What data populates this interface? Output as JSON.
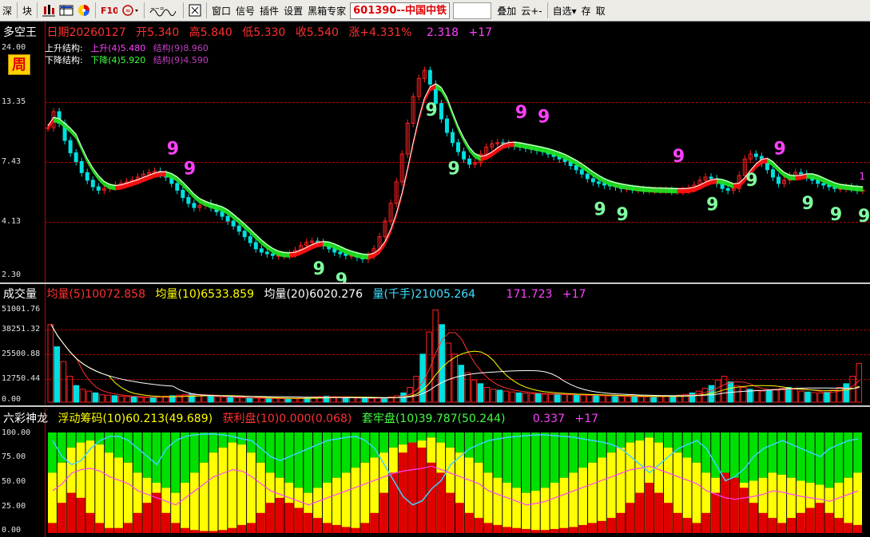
{
  "toolbar": {
    "buttons": [
      "深",
      "块",
      "窗口",
      "信号",
      "插件",
      "设置",
      "黑箱专家",
      "叠加",
      "云+-",
      "自选▾",
      "存",
      "取"
    ],
    "stock": "601390--中国中铁"
  },
  "price_panel": {
    "title": "多空王",
    "date": "日期20260127",
    "open": "开5.340",
    "high": "高5.840",
    "low": "低5.330",
    "close": "收5.540",
    "change": "涨+4.331%",
    "extra1": "2.318",
    "extra2": "+17",
    "period_badge": "周",
    "legend_up_label": "上升结构:",
    "legend_up_a": "上升(4)5.480",
    "legend_up_b": "结构(9)8.960",
    "legend_down_label": "下降结构:",
    "legend_down_a": "下降(4)5.920",
    "legend_down_b": "结构(9)4.590",
    "y_ticks": [
      "24.00",
      "13.35",
      "7.43",
      "4.13",
      "2.30"
    ],
    "right_marker": "1"
  },
  "volume_panel": {
    "title": "成交量",
    "ma5": "均量(5)10072.858",
    "ma10": "均量(10)6533.859",
    "ma20": "均量(20)6020.276",
    "vol": "量(千手)21005.264",
    "extra1": "171.723",
    "extra2": "+17",
    "y_ticks": [
      "51001.76",
      "38251.32",
      "25500.88",
      "12750.44",
      "0.00"
    ]
  },
  "chip_panel": {
    "title": "六彩神龙",
    "float": "浮动筹码(10)60.213(49.689)",
    "profit": "获利盘(10)0.000(0.068)",
    "trapped": "套牢盘(10)39.787(50.244)",
    "extra1": "0.337",
    "extra2": "+17",
    "y_ticks": [
      "100.00",
      "75.00",
      "50.00",
      "25.00",
      "0.00"
    ]
  },
  "colors": {
    "up": "#ff2020",
    "down": "#00e0e0",
    "bull_band": "#ff1010",
    "bear_band": "#20e020",
    "signal9_up": "#ff40ff",
    "signal9_down": "#80ffa0",
    "chip_green": "#00e000",
    "chip_yellow": "#ffff00",
    "chip_red": "#e00000"
  },
  "chart_data": [
    {
      "type": "line",
      "name": "price",
      "x": [
        0,
        4,
        8,
        12,
        16,
        20,
        24,
        28,
        32,
        36,
        40,
        44,
        48,
        52,
        56,
        60,
        64,
        68,
        72,
        76,
        80,
        84,
        88,
        92,
        96,
        100,
        104,
        108,
        112,
        116,
        120,
        124,
        128,
        132,
        136,
        140,
        144,
        148,
        152,
        156,
        160,
        164,
        168,
        172,
        176,
        180,
        184,
        188,
        192,
        196,
        200,
        204,
        208,
        212,
        216,
        220,
        224,
        228,
        232,
        236,
        240,
        244,
        248,
        252,
        256,
        260,
        264,
        268,
        272,
        276,
        280,
        284,
        288,
        292,
        296,
        300,
        304,
        308,
        312,
        316,
        320,
        324,
        328,
        332,
        336,
        340,
        344,
        348,
        352,
        356,
        360,
        364,
        368,
        372,
        376,
        380,
        384,
        388,
        392,
        396,
        400,
        404,
        408,
        412,
        416,
        420,
        424,
        428,
        432,
        436,
        440,
        444,
        448,
        452,
        456,
        460,
        464,
        468,
        472,
        476,
        480,
        484,
        488,
        492,
        496,
        500,
        504,
        508,
        512,
        516,
        520,
        524,
        528,
        532,
        536,
        540,
        544,
        548,
        552,
        556,
        560,
        564,
        568,
        572,
        576,
        580,
        584,
        588,
        592,
        596,
        600,
        604,
        608,
        612,
        616,
        620,
        624,
        628,
        632,
        636,
        640,
        644,
        648,
        652,
        656,
        660,
        664,
        668,
        672,
        676,
        680,
        684,
        688,
        692,
        696,
        700,
        704,
        708,
        712,
        716,
        720,
        724,
        728,
        732,
        736,
        740,
        744,
        748,
        752,
        756,
        760,
        764,
        768,
        772,
        776,
        780,
        784,
        788,
        792,
        796,
        800,
        804,
        808,
        812,
        816,
        820,
        824,
        828,
        832,
        836,
        840,
        844,
        848,
        852,
        856,
        860,
        864,
        868,
        872,
        876,
        880,
        884,
        888,
        892,
        896,
        900,
        904,
        908,
        912,
        916,
        920,
        924,
        928,
        932,
        936,
        940,
        944,
        948,
        952,
        956,
        960,
        964,
        968,
        972,
        976,
        980,
        984,
        988,
        992,
        996,
        1000,
        1004,
        1008,
        1012,
        1016
      ],
      "y": [
        10.5,
        12.4,
        11.0,
        9.2,
        8.1,
        7.4,
        6.6,
        6.1,
        5.7,
        5.5,
        5.6,
        5.7,
        5.8,
        5.9,
        6.0,
        6.1,
        6.3,
        6.5,
        6.6,
        6.7,
        6.5,
        6.3,
        5.9,
        5.5,
        5.1,
        4.8,
        4.6,
        4.7,
        4.8,
        4.6,
        4.4,
        4.2,
        4.0,
        3.8,
        3.6,
        3.4,
        3.2,
        3.0,
        2.9,
        2.85,
        2.8,
        2.8,
        2.8,
        2.85,
        2.95,
        3.1,
        3.2,
        3.25,
        3.2,
        3.1,
        3.0,
        2.9,
        2.85,
        2.8,
        2.8,
        2.75,
        2.7,
        2.8,
        3.0,
        3.4,
        4.0,
        4.8,
        6.0,
        8.0,
        11.0,
        14.5,
        17.5,
        19.0,
        16.5,
        13.5,
        11.5,
        10.0,
        9.0,
        8.2,
        7.6,
        7.2,
        7.3,
        8.0,
        8.6,
        8.9,
        9.0,
        8.9,
        8.8,
        8.7,
        8.6,
        8.5,
        8.4,
        8.3,
        8.2,
        8.0,
        7.8,
        7.6,
        7.4,
        7.1,
        6.8,
        6.5,
        6.2,
        6.0,
        5.9,
        5.8,
        5.75,
        5.7,
        5.6,
        5.6,
        5.55,
        5.55,
        5.5,
        5.5,
        5.5,
        5.5,
        5.5,
        5.45,
        5.45,
        5.5,
        5.6,
        5.8,
        6.1,
        6.3,
        6.2,
        5.9,
        5.6,
        5.5,
        5.6,
        6.4,
        7.6,
        8.0,
        7.8,
        7.3,
        6.8,
        6.3,
        5.9,
        6.1,
        6.4,
        6.6,
        6.5,
        6.3,
        6.1,
        5.9,
        5.8,
        5.7,
        5.6,
        5.6,
        5.7,
        5.6,
        5.5,
        5.5
      ],
      "xlabel": "",
      "ylabel": "",
      "ylim": [
        2.3,
        24.0
      ],
      "yscale": "log"
    },
    {
      "type": "bar",
      "name": "volume",
      "values": [
        42000,
        30000,
        22000,
        14000,
        9000,
        7000,
        6000,
        5000,
        4000,
        3800,
        3500,
        3200,
        3000,
        2800,
        2600,
        2500,
        2600,
        2800,
        3200,
        3500,
        3800,
        4200,
        4500,
        4000,
        3600,
        3200,
        3000,
        2800,
        2600,
        2500,
        2400,
        2300,
        2200,
        2100,
        2000,
        2000,
        1900,
        1900,
        2000,
        2200,
        2500,
        2800,
        3000,
        3200,
        3000,
        2800,
        2600,
        2400,
        2200,
        2100,
        2100,
        2200,
        2400,
        2800,
        3500,
        5000,
        8000,
        14000,
        26000,
        38000,
        50000,
        42000,
        32000,
        26000,
        20000,
        16000,
        12000,
        10000,
        8000,
        7000,
        6500,
        6000,
        5500,
        5000,
        4800,
        4600,
        4500,
        4400,
        4300,
        4200,
        4100,
        4000,
        3900,
        3800,
        3700,
        3600,
        3500,
        3400,
        3300,
        3200,
        3100,
        3000,
        2900,
        2900,
        3000,
        3100,
        3200,
        3400,
        3800,
        4200,
        5000,
        6000,
        7500,
        9000,
        12000,
        14000,
        11000,
        9000,
        8000,
        7000,
        6500,
        6000,
        6500,
        7000,
        7500,
        8000,
        7000,
        6000,
        5500,
        5200,
        5000,
        5500,
        6500,
        8000,
        10000,
        14000,
        21005
      ],
      "ylim": [
        0,
        51001.76
      ]
    },
    {
      "type": "area",
      "name": "chips",
      "series_float": [
        60,
        70,
        85,
        90,
        92,
        88,
        80,
        75,
        70,
        60,
        55,
        50,
        45,
        40,
        50,
        60,
        70,
        80,
        85,
        90,
        88,
        80,
        70,
        60,
        55,
        50,
        45,
        40,
        45,
        50,
        55,
        60,
        65,
        70,
        75,
        80,
        85,
        88,
        90,
        92,
        95,
        90,
        85,
        80,
        75,
        70,
        60,
        55,
        50,
        45,
        40,
        42,
        45,
        50,
        55,
        60,
        65,
        70,
        75,
        80,
        85,
        90,
        92,
        95,
        90,
        85,
        80,
        75,
        70,
        60,
        55,
        50,
        48,
        50,
        52,
        55,
        60,
        58,
        55,
        52,
        50,
        48,
        45,
        50,
        55,
        60
      ],
      "series_profit": [
        10,
        30,
        40,
        35,
        20,
        10,
        5,
        5,
        10,
        20,
        30,
        40,
        20,
        10,
        5,
        3,
        2,
        2,
        3,
        5,
        8,
        10,
        20,
        30,
        35,
        30,
        25,
        20,
        15,
        10,
        8,
        6,
        5,
        10,
        20,
        40,
        60,
        80,
        90,
        85,
        70,
        60,
        40,
        30,
        20,
        15,
        10,
        8,
        6,
        5,
        4,
        3,
        3,
        4,
        5,
        6,
        8,
        10,
        12,
        15,
        20,
        30,
        40,
        50,
        40,
        30,
        20,
        15,
        10,
        20,
        40,
        60,
        55,
        45,
        30,
        20,
        15,
        10,
        15,
        20,
        25,
        30,
        20,
        15,
        10,
        8
      ],
      "ylim": [
        0,
        100
      ]
    }
  ]
}
